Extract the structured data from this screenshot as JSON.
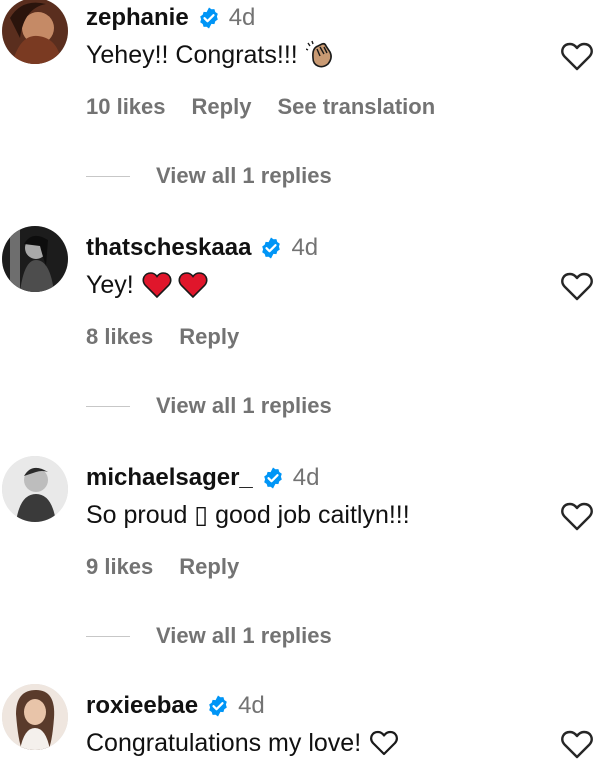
{
  "comments": [
    {
      "username": "zephanie",
      "time": "4d",
      "text": "Yehey!! Congrats!!!",
      "emoji": "clapping-hands-icon",
      "likes": "10 likes",
      "reply": "Reply",
      "translation": "See translation",
      "view_replies": "View all 1 replies"
    },
    {
      "username": "thatscheskaaa",
      "time": "4d",
      "text": "Yey!",
      "emoji": "red-heart-icon",
      "likes": "8 likes",
      "reply": "Reply",
      "view_replies": "View all 1 replies"
    },
    {
      "username": "michaelsager_",
      "time": "4d",
      "text": "So proud ▯ good job caitlyn!!!",
      "likes": "9 likes",
      "reply": "Reply",
      "view_replies": "View all 1 replies"
    },
    {
      "username": "roxieebae",
      "time": "4d",
      "text": "Congratulations my love!",
      "emoji": "outline-heart-icon"
    }
  ],
  "colors": {
    "verified": "#0095f6",
    "muted": "#737373",
    "heart_red": "#e0162b"
  }
}
